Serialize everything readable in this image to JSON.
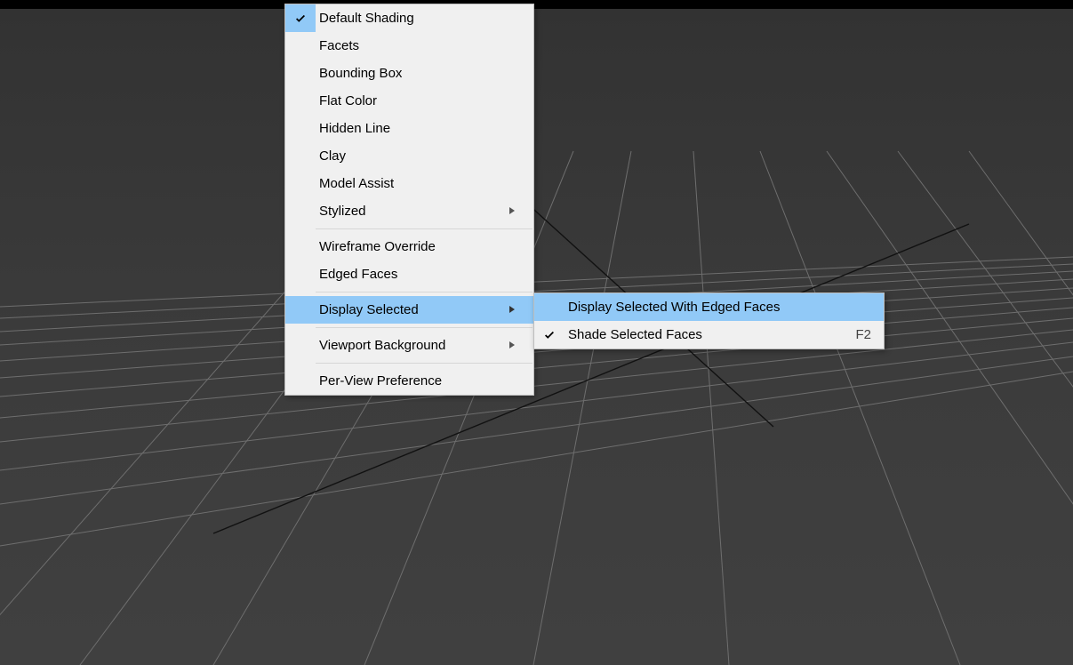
{
  "colors": {
    "highlight": "#91c9f7",
    "menu_bg": "#f0f0f0",
    "viewport": "#393939"
  },
  "menu1": {
    "items": [
      {
        "label": "Default Shading",
        "checked": true,
        "submenu": false
      },
      {
        "label": "Facets",
        "checked": false,
        "submenu": false
      },
      {
        "label": "Bounding Box",
        "checked": false,
        "submenu": false
      },
      {
        "label": "Flat Color",
        "checked": false,
        "submenu": false
      },
      {
        "label": "Hidden Line",
        "checked": false,
        "submenu": false
      },
      {
        "label": "Clay",
        "checked": false,
        "submenu": false
      },
      {
        "label": "Model Assist",
        "checked": false,
        "submenu": false
      },
      {
        "label": "Stylized",
        "checked": false,
        "submenu": true
      }
    ],
    "group2": [
      {
        "label": "Wireframe Override",
        "checked": false,
        "submenu": false
      },
      {
        "label": "Edged Faces",
        "checked": false,
        "submenu": false
      }
    ],
    "group3": [
      {
        "label": "Display Selected",
        "checked": false,
        "submenu": true,
        "highlighted": true
      }
    ],
    "group4": [
      {
        "label": "Viewport Background",
        "checked": false,
        "submenu": true
      }
    ],
    "group5": [
      {
        "label": "Per-View Preference",
        "checked": false,
        "submenu": false
      }
    ]
  },
  "menu2": {
    "items": [
      {
        "label": "Display Selected With Edged Faces",
        "checked": false,
        "highlighted": true,
        "shortcut": ""
      },
      {
        "label": "Shade Selected Faces",
        "checked": true,
        "highlighted": false,
        "shortcut": "F2"
      }
    ]
  }
}
